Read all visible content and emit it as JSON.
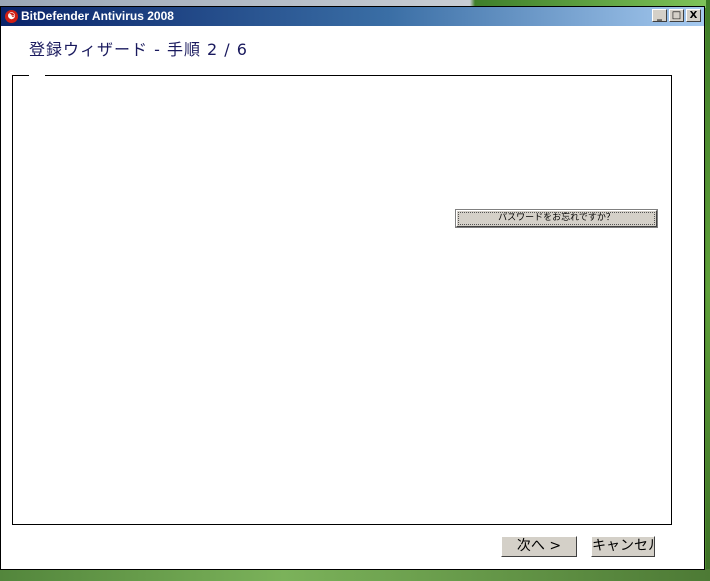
{
  "window": {
    "title": "BitDefender Antivirus 2008",
    "controls": {
      "minimize": "_",
      "maximize": "□",
      "close": "X"
    }
  },
  "wizard": {
    "step_title": "登録ウィザード - 手順 2 / 6",
    "forgot_password_label": "パスワードをお忘れですか？",
    "next_label": "次へ >",
    "cancel_label": "キャンセル"
  },
  "colors": {
    "titlebar_start": "#0a246a",
    "titlebar_end": "#a6caf0",
    "button_face": "#d4d0c8",
    "step_title_text": "#1a1a5e"
  },
  "icons": {
    "app": "bitdefender-logo-icon"
  }
}
